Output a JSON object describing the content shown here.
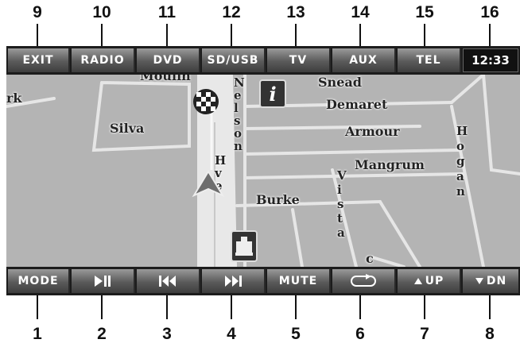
{
  "callouts_top": [
    "9",
    "10",
    "11",
    "12",
    "13",
    "14",
    "15",
    "16"
  ],
  "callouts_bottom": [
    "1",
    "2",
    "3",
    "4",
    "5",
    "6",
    "7",
    "8"
  ],
  "top_bar": {
    "buttons": [
      "EXIT",
      "RADIO",
      "DVD",
      "SD/USB",
      "TV",
      "AUX",
      "TEL"
    ],
    "clock": "12:33"
  },
  "bottom_bar": {
    "mode": "MODE",
    "mute": "MUTE",
    "up": "UP",
    "down": "DN"
  },
  "map": {
    "streets": {
      "snead": "Snead",
      "demaret": "Demaret",
      "armour": "Armour",
      "mangrum": "Mangrum",
      "burke": "Burke",
      "silva": "Silva",
      "nelson": "Nelson",
      "hogan": "Hogan",
      "vista": "Vista",
      "left_partial": "rk",
      "top_partial": "Moulin",
      "route_partial": "Hve"
    },
    "info_icon": "i"
  },
  "colors": {
    "bar": "#1c1c1c",
    "button_top": "#9a9a9a",
    "map_bg": "#b4b4b4",
    "route": "#e8e8e8"
  }
}
